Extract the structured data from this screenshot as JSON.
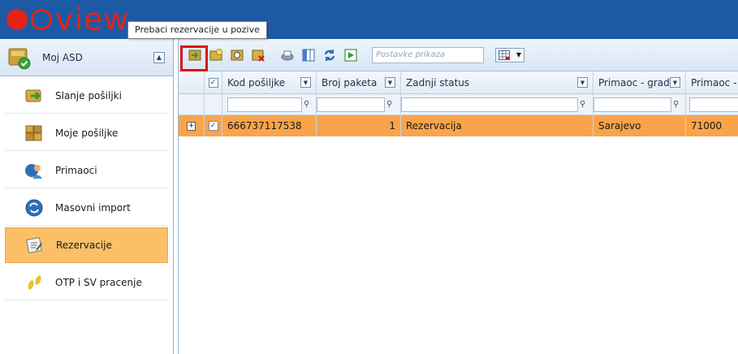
{
  "app": {
    "logo_text": "view"
  },
  "tooltip": {
    "text": "Prebaci rezervacije u pozive"
  },
  "sidebar": {
    "header_title": "Moj ASD",
    "items": [
      {
        "label": "Slanje pošiljki",
        "icon": "send-package-icon",
        "active": false
      },
      {
        "label": "Moje pošiljke",
        "icon": "my-packages-icon",
        "active": false
      },
      {
        "label": "Primaoci",
        "icon": "recipients-icon",
        "active": false
      },
      {
        "label": "Masovni import",
        "icon": "mass-import-icon",
        "active": false
      },
      {
        "label": "Rezervacije",
        "icon": "reservations-icon",
        "active": true
      },
      {
        "label": "OTP i SV pracenje",
        "icon": "footprints-icon",
        "active": false
      }
    ]
  },
  "toolbar": {
    "layout_placeholder": "Postavke prikaza",
    "highlight_color": "#d9121b"
  },
  "grid": {
    "headers": [
      "Kod pošiljke",
      "Broj paketa",
      "Zadnji status",
      "Primaoc - grad",
      "Primaoc -"
    ],
    "rows": [
      {
        "kod": "666737117538",
        "broj": "1",
        "status": "Rezervacija",
        "grad": "Sarajevo",
        "postanski": "71000"
      }
    ],
    "row_color": "#f9a44a"
  },
  "colors": {
    "topbar": "#1c5aa6",
    "brand_red": "#e2231a",
    "active_nav": "#fbbf68"
  }
}
